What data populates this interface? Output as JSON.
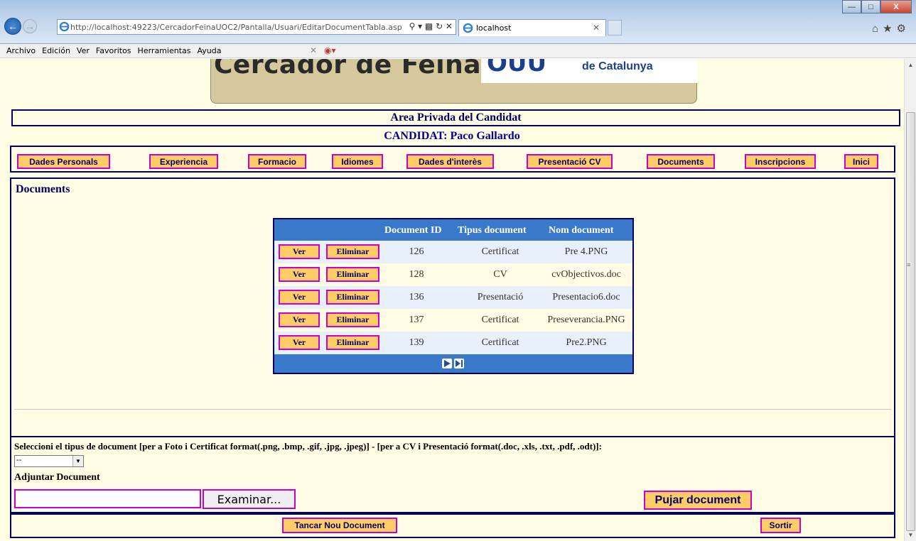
{
  "browser": {
    "address": "http://localhost:49223/CercadorFeinaUOC2/Pantalla/Usuari/EditarDocumentTabla.asp",
    "tab_title": "localhost",
    "menu": [
      "Archivo",
      "Edición",
      "Ver",
      "Favoritos",
      "Herramientas",
      "Ayuda"
    ]
  },
  "banner": {
    "title": "Cercador de Feina",
    "logo": "OUU",
    "subtitle": "de Catalunya"
  },
  "header": {
    "area": "Area Privada del Candidat",
    "candidate": "CANDIDAT: Paco Gallardo"
  },
  "nav": {
    "items": [
      {
        "label": "Dades Personals"
      },
      {
        "label": "Experiencia"
      },
      {
        "label": "Formacio"
      },
      {
        "label": "Idiomes"
      },
      {
        "label": "Dades d'interès"
      },
      {
        "label": "Presentació CV"
      },
      {
        "label": "Documents"
      },
      {
        "label": "Inscripcions"
      },
      {
        "label": "Inici"
      }
    ]
  },
  "documents": {
    "heading": "Documents",
    "columns": [
      "Document ID",
      "Tipus document",
      "Nom document"
    ],
    "ver_label": "Ver",
    "eliminar_label": "Eliminar",
    "rows": [
      {
        "id": "126",
        "tipus": "Certificat",
        "nom": "Pre 4.PNG"
      },
      {
        "id": "128",
        "tipus": "CV",
        "nom": "cvObjectivos.doc"
      },
      {
        "id": "136",
        "tipus": "Presentació",
        "nom": "Presentacio6.doc"
      },
      {
        "id": "137",
        "tipus": "Certificat",
        "nom": "Preseverancia.PNG"
      },
      {
        "id": "139",
        "tipus": "Certificat",
        "nom": "Pre2.PNG"
      }
    ]
  },
  "upload": {
    "select_label": "Seleccioni el tipus de document [per a Foto i Certificat format(.png, .bmp, .gif, .jpg, .jpeg)] - [per a CV i Presentació format(.doc, .xls, .txt, .pdf, .odt)]:",
    "select_value": "--",
    "adjuntar_label": "Adjuntar Document",
    "file_value": "",
    "examinar_label": "Examinar...",
    "pujar_label": "Pujar document"
  },
  "footer": {
    "tancar_label": "Tancar Nou Document",
    "sortir_label": "Sortir"
  },
  "colors": {
    "page_bg": "#fffde3",
    "button_bg": "#ffcc66",
    "button_border": "#cc00cc",
    "navy": "#000066",
    "grid_header": "#3a78c9"
  }
}
